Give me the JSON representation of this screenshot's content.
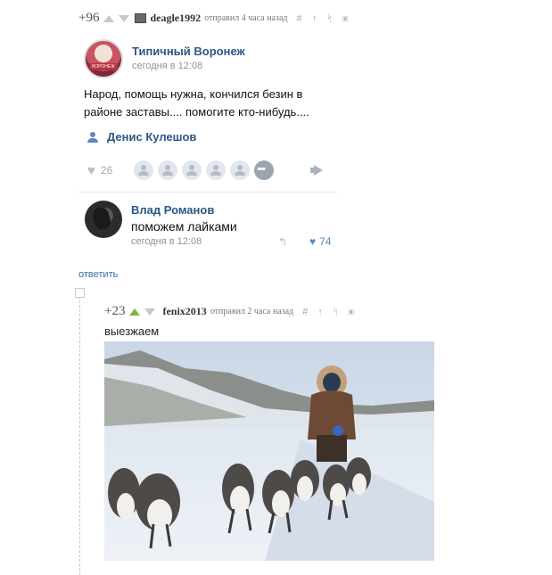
{
  "comment1": {
    "rating": "+96",
    "username": "deagle1992",
    "meta": "отправил 4 часа назад",
    "tools": "# ↑ ᛋ ▣"
  },
  "vk_post": {
    "group_name": "Типичный Воронеж",
    "avatar_ribbon": "ВОРОНЕЖ",
    "time": "сегодня в 12:08",
    "text": "Народ, помощь нужна,  кончился безин в районе заставы....  помогите кто-нибудь....",
    "signer": "Денис Кулешов",
    "likes": "26",
    "more_likers": "•••",
    "reply": {
      "name": "Влад Романов",
      "text": "поможем лайками",
      "time": "сегодня в 12:08",
      "share_icon": "↰",
      "likes": "74"
    }
  },
  "answer_link": "ответить",
  "comment2": {
    "rating": "+23",
    "username": "fenix2013",
    "meta": "отправил 2 часа назад",
    "tools": "# ↑ ᛋ ▣",
    "text": "выезжаем"
  },
  "colors": {
    "vk_blue": "#2a5885",
    "upvote_green": "#7ab648",
    "snow": "#e6edf5"
  }
}
